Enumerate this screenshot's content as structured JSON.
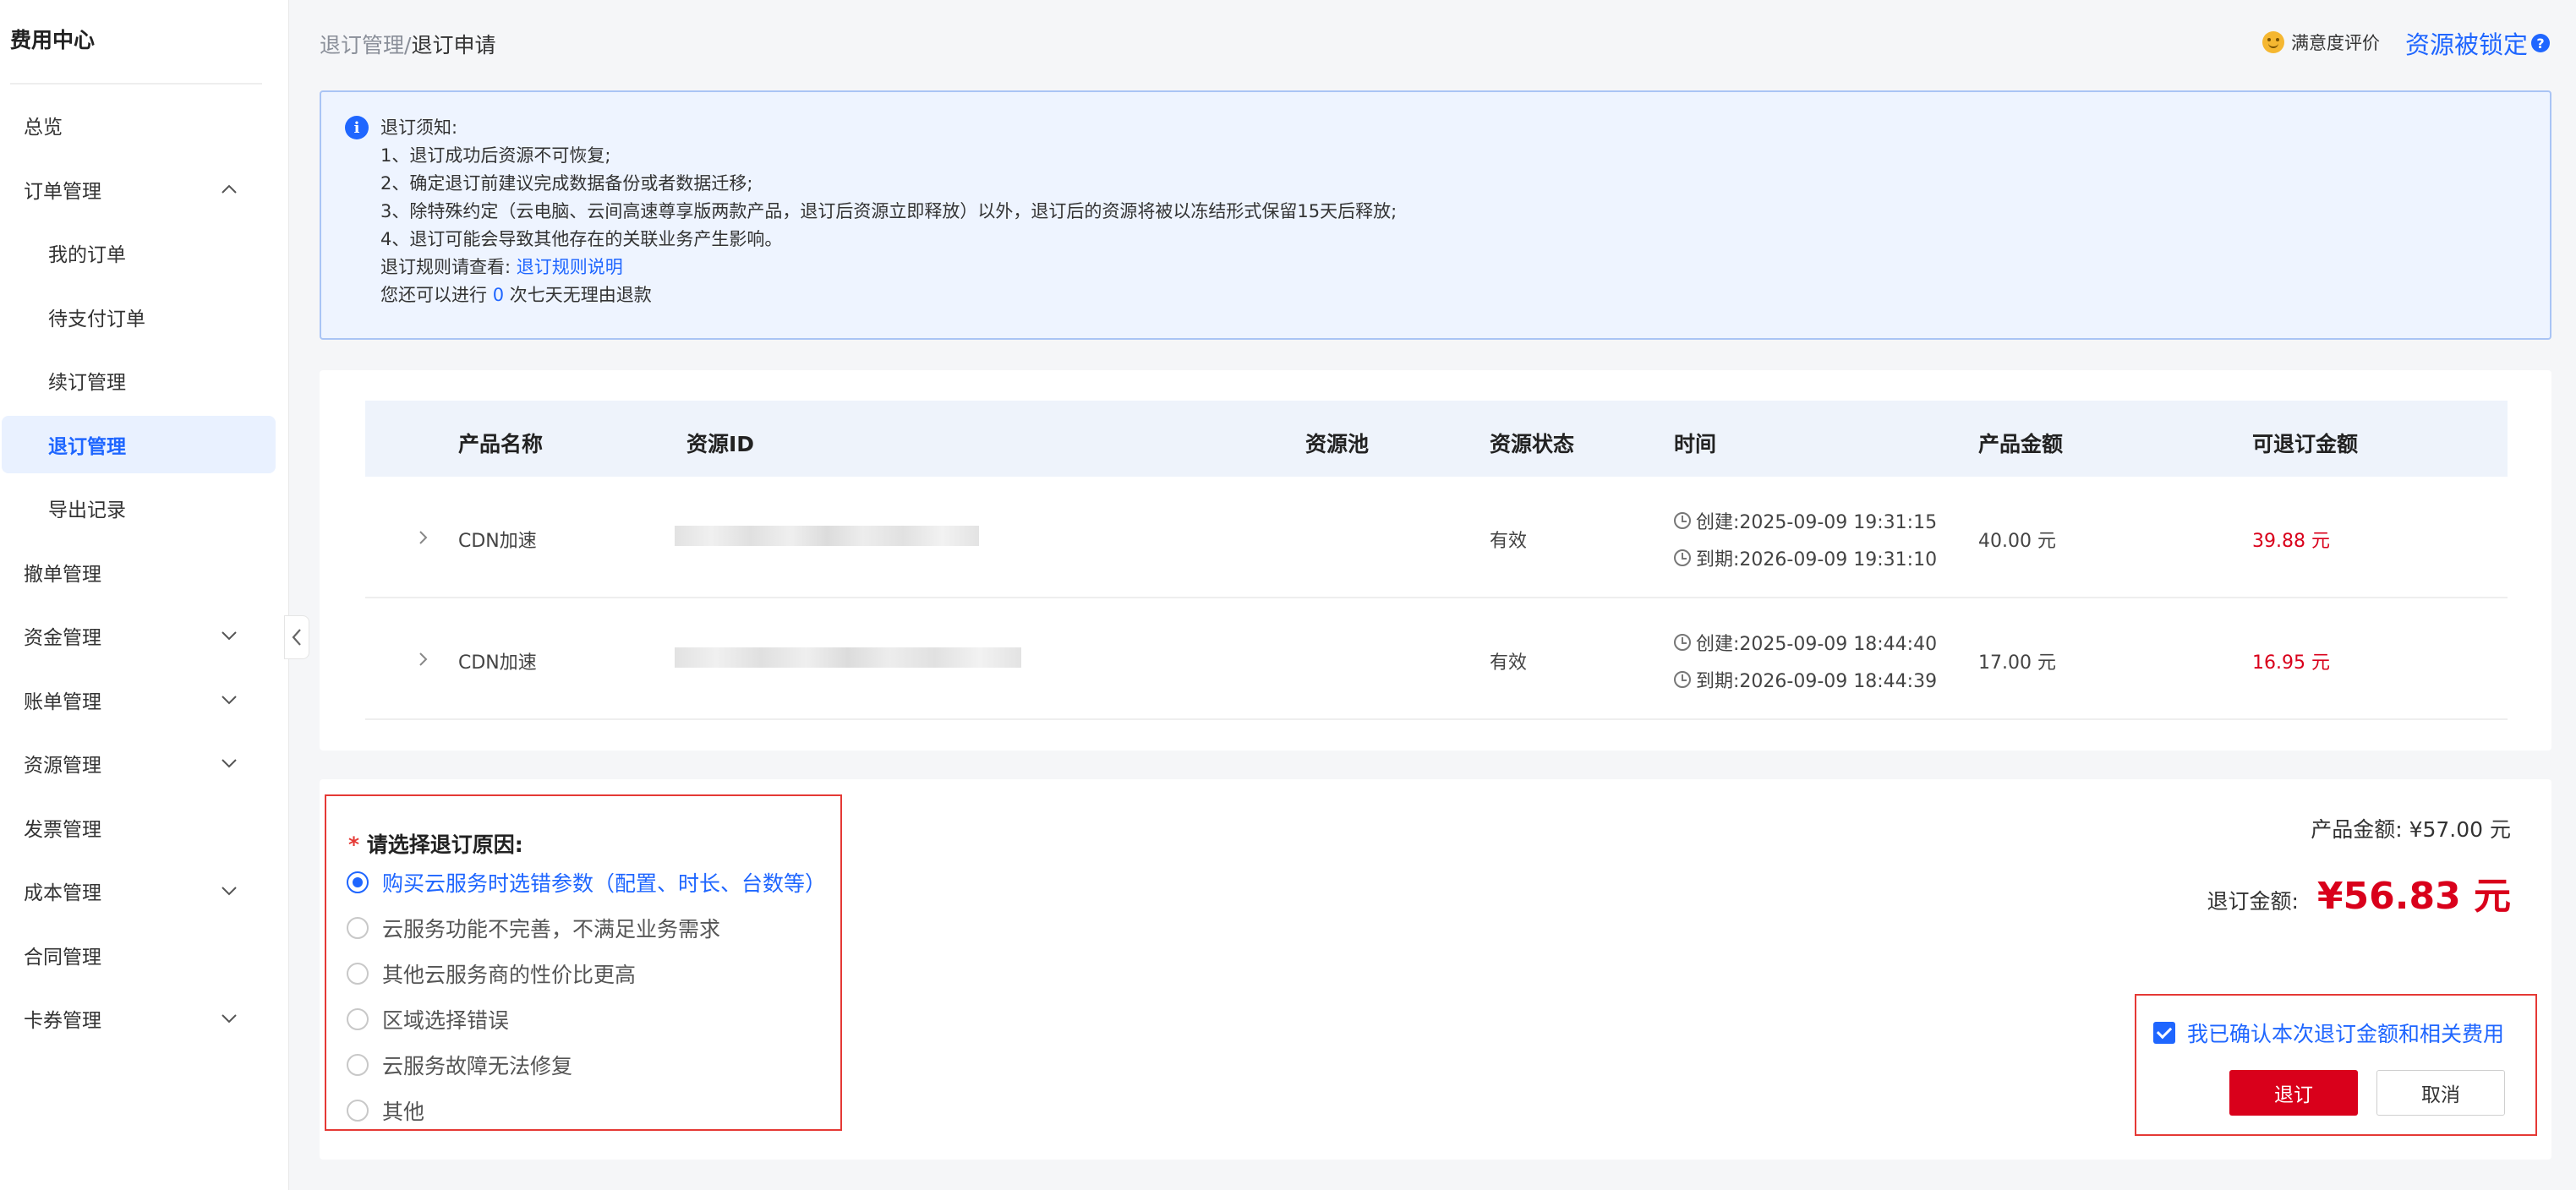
{
  "sidebar": {
    "title": "费用中心",
    "items": [
      {
        "label": "总览",
        "sub": false,
        "chev": null
      },
      {
        "label": "订单管理",
        "sub": false,
        "chev": "up"
      },
      {
        "label": "我的订单",
        "sub": true,
        "chev": null
      },
      {
        "label": "待支付订单",
        "sub": true,
        "chev": null
      },
      {
        "label": "续订管理",
        "sub": true,
        "chev": null
      },
      {
        "label": "退订管理",
        "sub": true,
        "chev": null,
        "active": true
      },
      {
        "label": "导出记录",
        "sub": true,
        "chev": null
      },
      {
        "label": "撤单管理",
        "sub": false,
        "chev": null
      },
      {
        "label": "资金管理",
        "sub": false,
        "chev": "down"
      },
      {
        "label": "账单管理",
        "sub": false,
        "chev": "down"
      },
      {
        "label": "资源管理",
        "sub": false,
        "chev": "down"
      },
      {
        "label": "发票管理",
        "sub": false,
        "chev": null
      },
      {
        "label": "成本管理",
        "sub": false,
        "chev": "down"
      },
      {
        "label": "合同管理",
        "sub": false,
        "chev": null
      },
      {
        "label": "卡券管理",
        "sub": false,
        "chev": "down"
      }
    ]
  },
  "header": {
    "breadcrumb_parent": "退订管理",
    "breadcrumb_sep": "/",
    "breadcrumb_current": "退订申请",
    "satisfaction": "满意度评价",
    "resource_locked": "资源被锁定"
  },
  "notice": {
    "title": "退订须知:",
    "lines": [
      "1、退订成功后资源不可恢复;",
      "2、确定退订前建议完成数据备份或者数据迁移;",
      "3、除特殊约定（云电脑、云间高速尊享版两款产品，退订后资源立即释放）以外，退订后的资源将被以冻结形式保留15天后释放;",
      "4、退订可能会导致其他存在的关联业务产生影响。"
    ],
    "rule_prefix": "退订规则请查看:",
    "rule_link": "退订规则说明",
    "refund_prefix": "您还可以进行",
    "refund_count": "0",
    "refund_suffix": "次七天无理由退款"
  },
  "table": {
    "columns": [
      "产品名称",
      "资源ID",
      "资源池",
      "资源状态",
      "时间",
      "产品金额",
      "可退订金额"
    ],
    "rows": [
      {
        "product": "CDN加速",
        "status": "有效",
        "created": "创建:2025-09-09 19:31:15",
        "expire": "到期:2026-09-09 19:31:10",
        "amount": "40.00 元",
        "refundable": "39.88 元"
      },
      {
        "product": "CDN加速",
        "status": "有效",
        "created": "创建:2025-09-09 18:44:40",
        "expire": "到期:2026-09-09 18:44:39",
        "amount": "17.00 元",
        "refundable": "16.95 元"
      }
    ]
  },
  "reasons": {
    "required_mark": "*",
    "title": "请选择退订原因:",
    "options": [
      "购买云服务时选错参数（配置、时长、台数等）",
      "云服务功能不完善，不满足业务需求",
      "其他云服务商的性价比更高",
      "区域选择错误",
      "云服务故障无法修复",
      "其他"
    ],
    "selected_index": 0
  },
  "summary": {
    "product_amount": "产品金额:  ¥57.00 元",
    "refund_label": "退订金额:",
    "refund_value": "¥56.83 元"
  },
  "confirm": {
    "checkbox_label": "我已确认本次退订金额和相关费用",
    "checked": true,
    "submit": "退订",
    "cancel": "取消"
  },
  "colors": {
    "accent": "#1f66ff",
    "danger": "#d9001b"
  }
}
